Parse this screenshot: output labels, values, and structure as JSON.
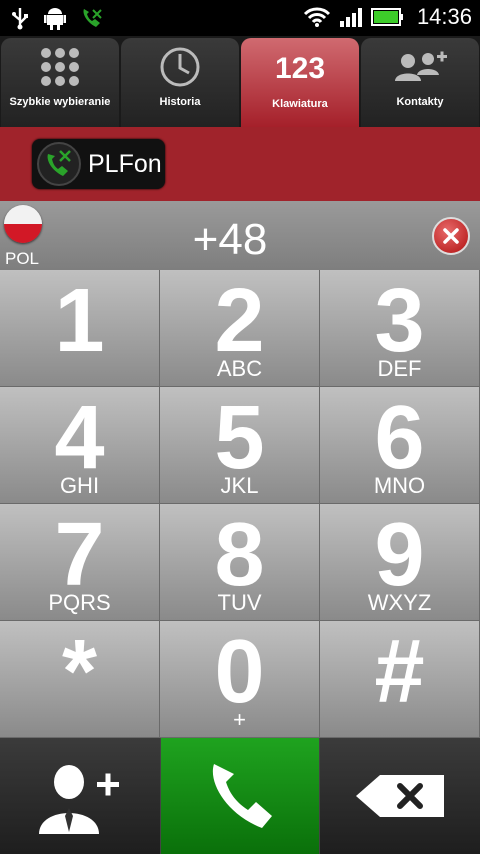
{
  "status_bar": {
    "time": "14:36",
    "icons": [
      "usb-icon",
      "android-debug-icon",
      "phone-status-icon",
      "wifi-icon",
      "signal-icon",
      "battery-icon"
    ]
  },
  "tabs": [
    {
      "label": "Szybkie wybieranie",
      "icon": "grid-icon"
    },
    {
      "label": "Historia",
      "icon": "clock-icon"
    },
    {
      "label": "Klawiatura",
      "icon": "keypad-123",
      "glyph": "123",
      "active": true
    },
    {
      "label": "Kontakty",
      "icon": "contacts-icon"
    }
  ],
  "brand": {
    "label": "PLFon"
  },
  "dial": {
    "country": "POL",
    "number": "+48"
  },
  "keypad": [
    {
      "digit": "1",
      "letters": ""
    },
    {
      "digit": "2",
      "letters": "ABC"
    },
    {
      "digit": "3",
      "letters": "DEF"
    },
    {
      "digit": "4",
      "letters": "GHI"
    },
    {
      "digit": "5",
      "letters": "JKL"
    },
    {
      "digit": "6",
      "letters": "MNO"
    },
    {
      "digit": "7",
      "letters": "PQRS"
    },
    {
      "digit": "8",
      "letters": "TUV"
    },
    {
      "digit": "9",
      "letters": "WXYZ"
    },
    {
      "digit": "*",
      "letters": ""
    },
    {
      "digit": "0",
      "letters": "+"
    },
    {
      "digit": "#",
      "letters": ""
    }
  ],
  "colors": {
    "brand_red": "#a0232b",
    "call_green": "#1a9a1a",
    "key_gray": "#a6a6a6"
  }
}
